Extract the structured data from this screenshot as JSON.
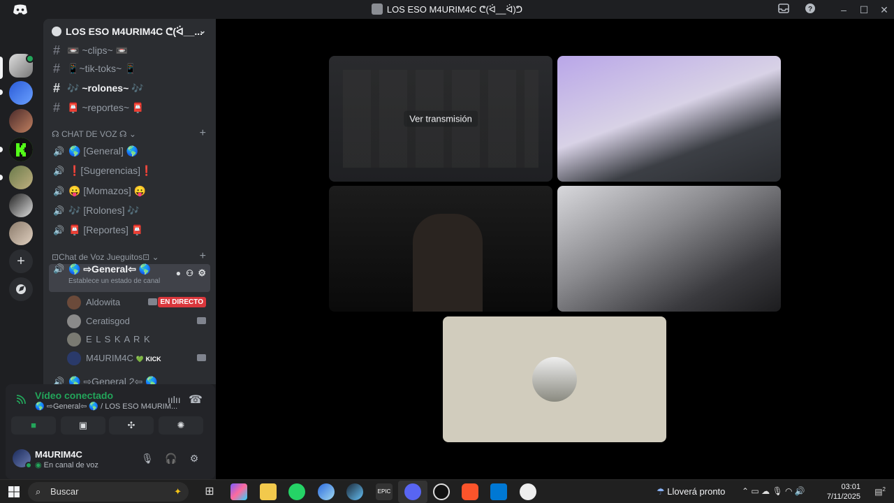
{
  "window": {
    "title": "LOS ESO M4URIM4C ᕦ(ᐛ__ᐛ)ᕤ"
  },
  "server": {
    "name": "LOS ESO M4URIM4C ᕦ(ᐛ__..."
  },
  "text_channels": [
    {
      "label": "📼 ~clips~ 📼",
      "active": false
    },
    {
      "label": "📱~tik-toks~ 📱",
      "active": false
    },
    {
      "label": "🎶 ~rolones~ 🎶",
      "active": true
    },
    {
      "label": "📮 ~reportes~ 📮",
      "active": false
    }
  ],
  "category_voice": {
    "label": "☊ CHAT DE VOZ ☊"
  },
  "voice_channels": [
    {
      "label": "🌎 [General] 🌎"
    },
    {
      "label": "❗[Sugerencias]❗"
    },
    {
      "label": "😛 [Momazos] 😛"
    },
    {
      "label": "🎶 [Rolones] 🎶"
    },
    {
      "label": "📮 [Reportes] 📮"
    }
  ],
  "category_games": {
    "label": "⊡Chat de Voz Jueguitos⊡"
  },
  "selected_channel": {
    "label": "🌎 ⇨General⇦ 🌎",
    "status_hint": "Establece un estado de canal"
  },
  "voice_users": [
    {
      "name": "Aldowita",
      "badge": "EN DIRECTO",
      "avatar_color": "#6b4a3a"
    },
    {
      "name": "Ceratisgod",
      "badge": "",
      "avatar_color": "#8a8a8a"
    },
    {
      "name": "E L S K A R K",
      "badge": "",
      "avatar_color": "#7a7a72"
    },
    {
      "name": "M4URIM4C",
      "badge": "💚 KICK",
      "avatar_color": "#2a3a6a"
    }
  ],
  "next_channel": {
    "label": "🌎 ⇨General 2⇦ 🌎"
  },
  "voice_panel": {
    "title": "Vídeo conectado",
    "subtitle": "🌎 ⇨General⇦ 🌎 / LOS ESO M4URIM..."
  },
  "user_panel": {
    "name": "M4URIM4C",
    "status": "En canal de voz"
  },
  "stage": {
    "watch_label": "Ver transmisión"
  },
  "taskbar": {
    "search_placeholder": "Buscar",
    "weather": "Lloverá pronto",
    "time": "03:01",
    "date": "7/11/2025",
    "notifications": "2"
  },
  "colors": {
    "accent_green": "#23a55a",
    "live_red": "#da373c",
    "sidebar_bg": "#2b2d31",
    "rail_bg": "#1e1f22"
  }
}
